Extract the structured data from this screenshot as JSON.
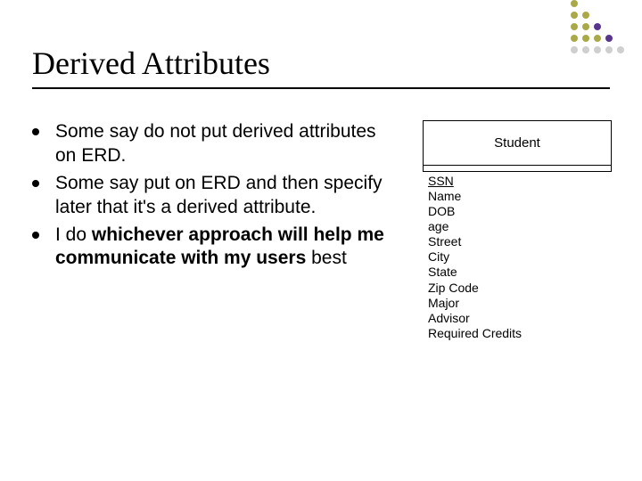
{
  "deco": {
    "columns": [
      [
        "olive",
        "olive",
        "olive",
        "olive",
        "grey"
      ],
      [
        "olive",
        "olive",
        "olive",
        "grey"
      ],
      [
        "purple",
        "olive",
        "grey"
      ],
      [
        "purple",
        "grey"
      ],
      [
        "grey"
      ]
    ]
  },
  "title": "Derived Attributes",
  "bullets": [
    {
      "text": "Some say do not put derived attributes on ERD."
    },
    {
      "text": "Some say put on ERD and then specify later that it's a derived attribute."
    },
    {
      "html": "I do <b>whichever approach will help me communicate with my users</b> best"
    }
  ],
  "entity": {
    "name": "Student",
    "pk": "SSN",
    "attributes": [
      "Name",
      "DOB",
      "age",
      "Street",
      "City",
      "State",
      "Zip Code",
      "Major",
      "Advisor",
      "Required Credits"
    ]
  }
}
